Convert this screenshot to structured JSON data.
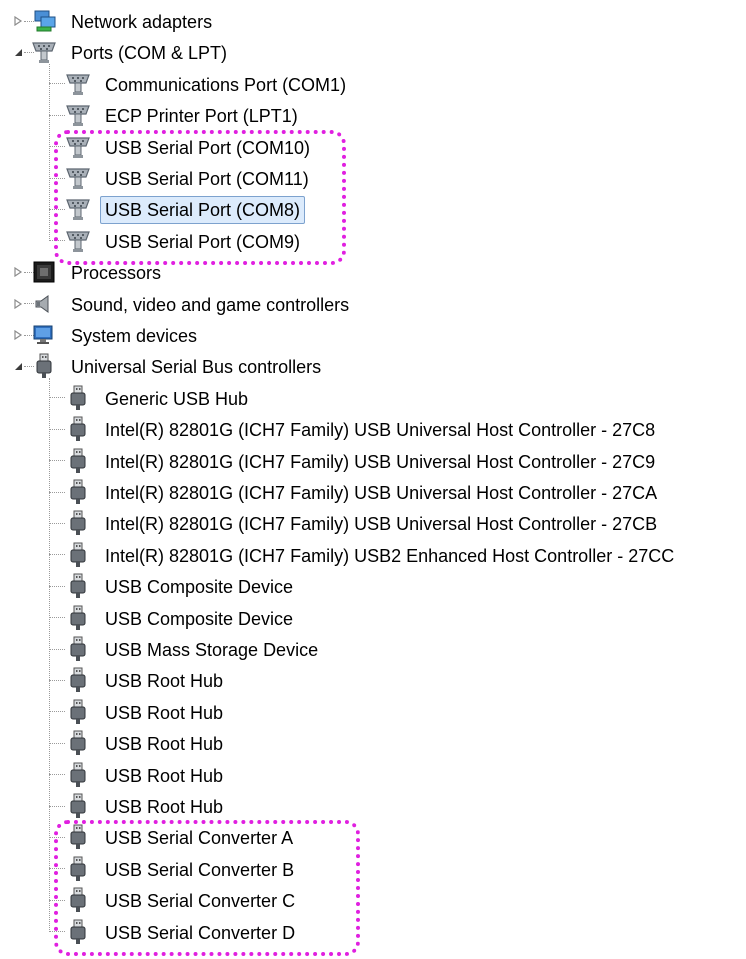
{
  "tree": {
    "categories": [
      {
        "label": "Network adapters",
        "icon": "network-adapter-icon",
        "state": "collapsed"
      },
      {
        "label": "Ports (COM & LPT)",
        "icon": "port-icon",
        "state": "expanded",
        "children": [
          {
            "label": "Communications Port (COM1)",
            "icon": "port-icon"
          },
          {
            "label": "ECP Printer Port (LPT1)",
            "icon": "port-icon"
          },
          {
            "label": "USB Serial Port (COM10)",
            "icon": "port-icon"
          },
          {
            "label": "USB Serial Port (COM11)",
            "icon": "port-icon"
          },
          {
            "label": "USB Serial Port (COM8)",
            "icon": "port-icon",
            "selected": true
          },
          {
            "label": "USB Serial Port (COM9)",
            "icon": "port-icon"
          }
        ]
      },
      {
        "label": "Processors",
        "icon": "processor-icon",
        "state": "collapsed"
      },
      {
        "label": "Sound, video and game controllers",
        "icon": "speaker-icon",
        "state": "collapsed"
      },
      {
        "label": "System devices",
        "icon": "system-devices-icon",
        "state": "collapsed"
      },
      {
        "label": "Universal Serial Bus controllers",
        "icon": "usb-icon",
        "state": "expanded",
        "children": [
          {
            "label": "Generic USB Hub",
            "icon": "usb-icon"
          },
          {
            "label": "Intel(R) 82801G (ICH7 Family) USB Universal Host Controller - 27C8",
            "icon": "usb-icon"
          },
          {
            "label": "Intel(R) 82801G (ICH7 Family) USB Universal Host Controller - 27C9",
            "icon": "usb-icon"
          },
          {
            "label": "Intel(R) 82801G (ICH7 Family) USB Universal Host Controller - 27CA",
            "icon": "usb-icon"
          },
          {
            "label": "Intel(R) 82801G (ICH7 Family) USB Universal Host Controller - 27CB",
            "icon": "usb-icon"
          },
          {
            "label": "Intel(R) 82801G (ICH7 Family) USB2 Enhanced Host Controller - 27CC",
            "icon": "usb-icon"
          },
          {
            "label": "USB Composite Device",
            "icon": "usb-icon"
          },
          {
            "label": "USB Composite Device",
            "icon": "usb-icon"
          },
          {
            "label": "USB Mass Storage Device",
            "icon": "usb-icon"
          },
          {
            "label": "USB Root Hub",
            "icon": "usb-icon"
          },
          {
            "label": "USB Root Hub",
            "icon": "usb-icon"
          },
          {
            "label": "USB Root Hub",
            "icon": "usb-icon"
          },
          {
            "label": "USB Root Hub",
            "icon": "usb-icon"
          },
          {
            "label": "USB Root Hub",
            "icon": "usb-icon"
          },
          {
            "label": "USB Serial Converter A",
            "icon": "usb-icon"
          },
          {
            "label": "USB Serial Converter B",
            "icon": "usb-icon"
          },
          {
            "label": "USB Serial Converter C",
            "icon": "usb-icon"
          },
          {
            "label": "USB Serial Converter D",
            "icon": "usb-icon"
          }
        ]
      }
    ]
  },
  "colors": {
    "highlight": "#e020e0",
    "selection_fill": "#dcebfc",
    "selection_border": "#7da2ce",
    "tree_line": "#9a9a9a"
  }
}
